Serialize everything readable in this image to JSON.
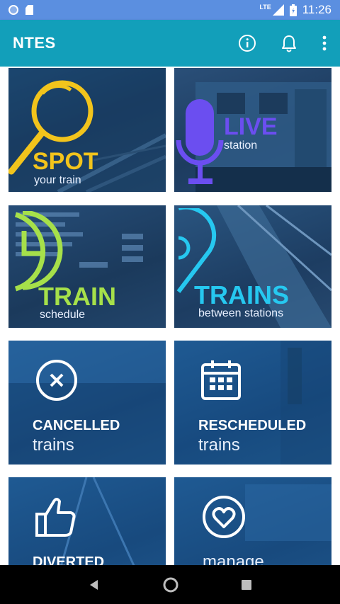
{
  "status": {
    "time": "11:26",
    "network": "LTE"
  },
  "appbar": {
    "title": "NTES"
  },
  "tiles": {
    "spot": {
      "title": "SPOT",
      "subtitle": "your train"
    },
    "live": {
      "title": "LIVE",
      "subtitle": "station"
    },
    "train": {
      "title": "TRAIN",
      "subtitle": "schedule"
    },
    "trains": {
      "title": "TRAINS",
      "subtitle": "between stations"
    },
    "cancelled": {
      "title": "CANCELLED",
      "subtitle": "trains"
    },
    "rescheduled": {
      "title": "RESCHEDULED",
      "subtitle": "trains"
    },
    "diverted": {
      "title": "DIVERTED"
    },
    "manage": {
      "title": "manage"
    }
  },
  "colors": {
    "appbar": "#129fba",
    "statusbar": "#5b8fe0",
    "spot_accent": "#f2c41c",
    "live_accent": "#6b4ef0",
    "train_accent": "#a6e04a",
    "trains_accent": "#26c8f0"
  }
}
